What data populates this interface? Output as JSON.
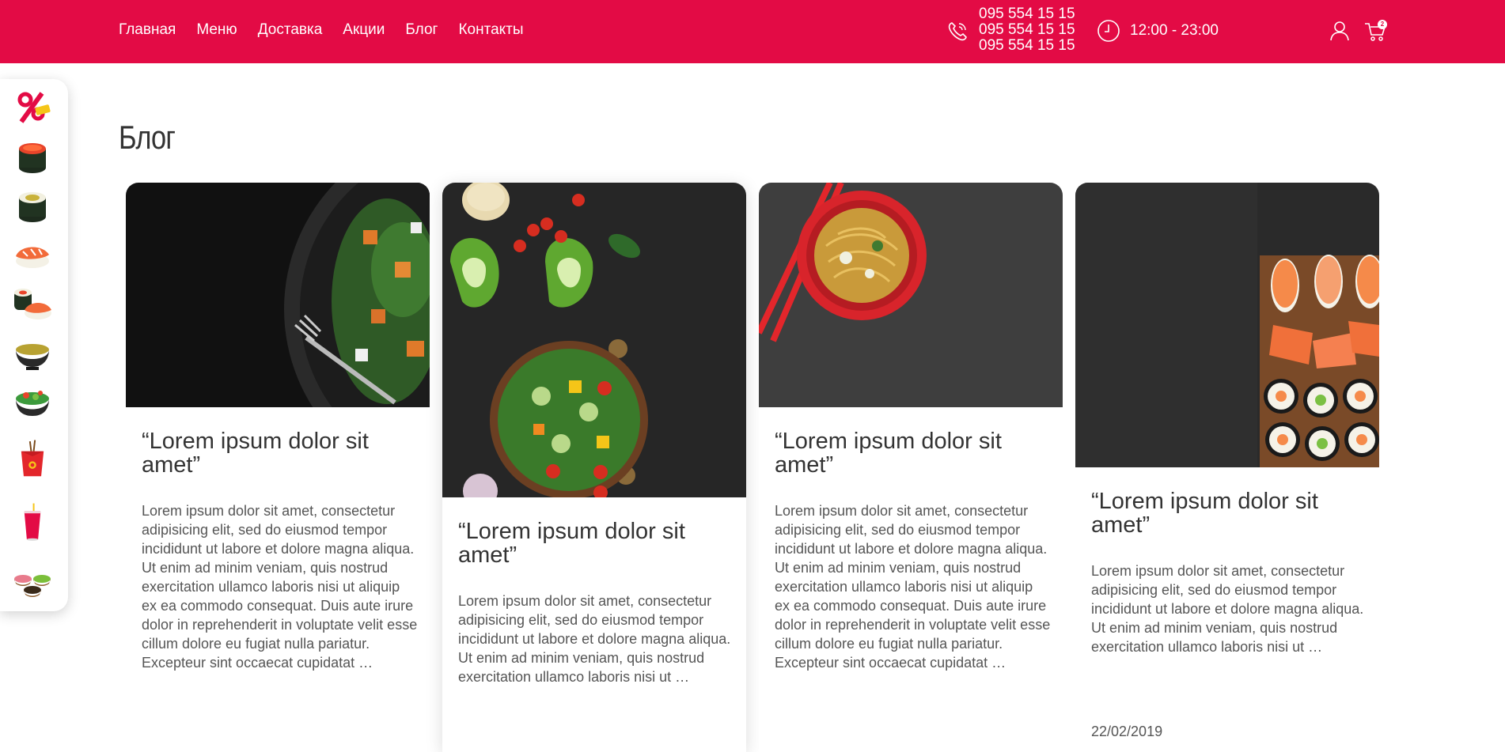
{
  "header": {
    "nav": [
      "Главная",
      "Меню",
      "Доставка",
      "Акции",
      "Блог",
      "Контакты"
    ],
    "phones": [
      "095 554 15 15",
      "095 554 15 15",
      "095 554 15 15"
    ],
    "hours": "12:00 - 23:00",
    "cart_count": "2",
    "brand_color": "#e30b45"
  },
  "sidebar": {
    "items": [
      "sale-percent-icon",
      "gunkan-roll-icon",
      "maki-roll-icon",
      "nigiri-icon",
      "sushi-set-icon",
      "soup-bowl-icon",
      "salad-bowl-icon",
      "wok-box-icon",
      "drink-cup-icon",
      "sauces-icon"
    ]
  },
  "page": {
    "title": "Блог"
  },
  "posts": [
    {
      "title": "“Lorem ipsum dolor sit amet”",
      "text": "Lorem ipsum dolor sit amet, consectetur adipisicing elit, sed do eiusmod tempor incididunt ut labore et dolore magna aliqua. Ut enim ad minim veniam, quis nostrud exercitation ullamco laboris nisi ut aliquip ex ea commodo consequat. Duis aute irure dolor in reprehenderit in voluptate velit esse cillum dolore eu fugiat nulla pariatur. Excepteur sint occaecat cupidatat …",
      "date": ""
    },
    {
      "title": "“Lorem ipsum dolor sit amet”",
      "text": "Lorem ipsum dolor sit amet, consectetur adipisicing elit, sed do eiusmod tempor incididunt ut labore et dolore magna aliqua. Ut enim ad minim veniam, quis nostrud exercitation ullamco laboris nisi ut …",
      "date": ""
    },
    {
      "title": "“Lorem ipsum dolor sit amet”",
      "text": "Lorem ipsum dolor sit amet, consectetur adipisicing elit, sed do eiusmod tempor incididunt ut labore et dolore magna aliqua. Ut enim ad minim veniam, quis nostrud exercitation ullamco laboris nisi ut aliquip ex ea commodo consequat. Duis aute irure dolor in reprehenderit in voluptate velit esse cillum dolore eu fugiat nulla pariatur. Excepteur sint occaecat cupidatat …",
      "date": ""
    },
    {
      "title": "“Lorem ipsum dolor sit amet”",
      "text": "Lorem ipsum dolor sit amet, consectetur adipisicing elit, sed do eiusmod tempor incididunt ut labore et dolore magna aliqua. Ut enim ad minim veniam, quis nostrud exercitation ullamco laboris nisi ut …",
      "date": "22/02/2019"
    }
  ]
}
